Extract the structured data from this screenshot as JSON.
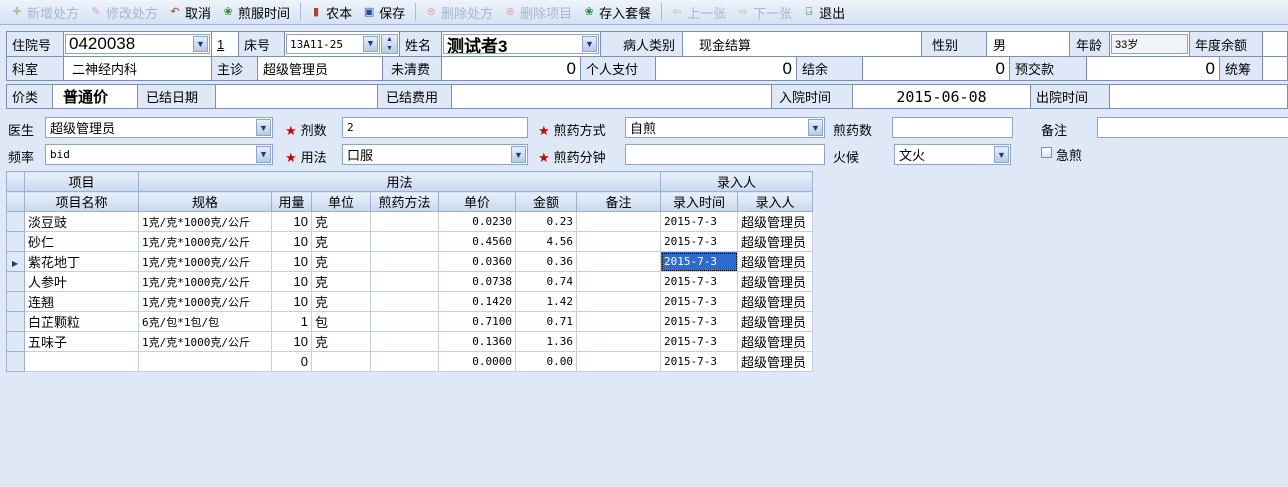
{
  "toolbar": {
    "new_rx": "新增处方",
    "edit_rx": "修改处方",
    "cancel": "取消",
    "decoct_time": "煎服时间",
    "nongben": "农本",
    "save": "保存",
    "delete_rx": "删除处方",
    "delete_item": "删除项目",
    "save_package": "存入套餐",
    "prev": "上一张",
    "next": "下一张",
    "exit": "退出"
  },
  "patient": {
    "inpatient_no_label": "住院号",
    "inpatient_no": "0420038",
    "seq": "1",
    "bed_label": "床号",
    "bed": "13A11-25",
    "name_label": "姓名",
    "name": "测试者3",
    "type_label": "病人类别",
    "type": "现金结算",
    "gender_label": "性别",
    "gender": "男",
    "age_label": "年龄",
    "age": "33岁",
    "annual_balance_label": "年度余额",
    "dept_label": "科室",
    "dept": "二神经内科",
    "doctor_label": "主诊",
    "doctor": "超级管理员",
    "unsettled_label": "未清费",
    "unsettled": "0",
    "self_pay_label": "个人支付",
    "self_pay": "0",
    "balance_label": "结余",
    "balance": "0",
    "prepaid_label": "预交款",
    "prepaid": "0",
    "pooled_label": "统筹",
    "price_type_label": "价类",
    "price_type": "普通价",
    "settled_date_label": "已结日期",
    "settled_fee_label": "已结费用",
    "admit_time_label": "入院时间",
    "admit_time": "2015-06-08",
    "discharge_time_label": "出院时间"
  },
  "form": {
    "doctor_label": "医生",
    "doctor": "超级管理员",
    "doses_label": "剂数",
    "doses": "2",
    "decoct_method_label": "煎药方式",
    "decoct_method": "自煎",
    "decoct_count_label": "煎药数",
    "decoct_count": "",
    "remark_label": "备注",
    "remark": "",
    "frequency_label": "频率",
    "frequency": "bid",
    "usage_label": "用法",
    "usage": "口服",
    "decoct_minutes_label": "煎药分钟",
    "decoct_minutes": "",
    "fire_label": "火候",
    "fire": "文火",
    "urgent_label": "急煎"
  },
  "grid": {
    "group_item": "项目",
    "group_usage": "用法",
    "group_entry": "录入人",
    "columns": [
      "项目名称",
      "规格",
      "用量",
      "单位",
      "煎药方法",
      "单价",
      "金额",
      "备注",
      "录入时间",
      "录入人"
    ],
    "rows": [
      [
        "淡豆豉",
        "1克/克*1000克/公斤",
        "10",
        "克",
        "",
        "0.0230",
        "0.23",
        "",
        "2015-7-3",
        "超级管理员"
      ],
      [
        "砂仁",
        "1克/克*1000克/公斤",
        "10",
        "克",
        "",
        "0.4560",
        "4.56",
        "",
        "2015-7-3",
        "超级管理员"
      ],
      [
        "紫花地丁",
        "1克/克*1000克/公斤",
        "10",
        "克",
        "",
        "0.0360",
        "0.36",
        "",
        "2015-7-3",
        "超级管理员"
      ],
      [
        "人参叶",
        "1克/克*1000克/公斤",
        "10",
        "克",
        "",
        "0.0738",
        "0.74",
        "",
        "2015-7-3",
        "超级管理员"
      ],
      [
        "连翘",
        "1克/克*1000克/公斤",
        "10",
        "克",
        "",
        "0.1420",
        "1.42",
        "",
        "2015-7-3",
        "超级管理员"
      ],
      [
        "白芷颗粒",
        "6克/包*1包/包",
        "1",
        "包",
        "",
        "0.7100",
        "0.71",
        "",
        "2015-7-3",
        "超级管理员"
      ],
      [
        "五味子",
        "1克/克*1000克/公斤",
        "10",
        "克",
        "",
        "0.1360",
        "1.36",
        "",
        "2015-7-3",
        "超级管理员"
      ],
      [
        "",
        "",
        "0",
        "",
        "",
        "0.0000",
        "0.00",
        "",
        "2015-7-3",
        "超级管理员"
      ]
    ],
    "selected_row": 2
  },
  "colors": {
    "background": "#dfe8f6",
    "selection": "#2e6bd0",
    "required_star": "#d20000"
  }
}
